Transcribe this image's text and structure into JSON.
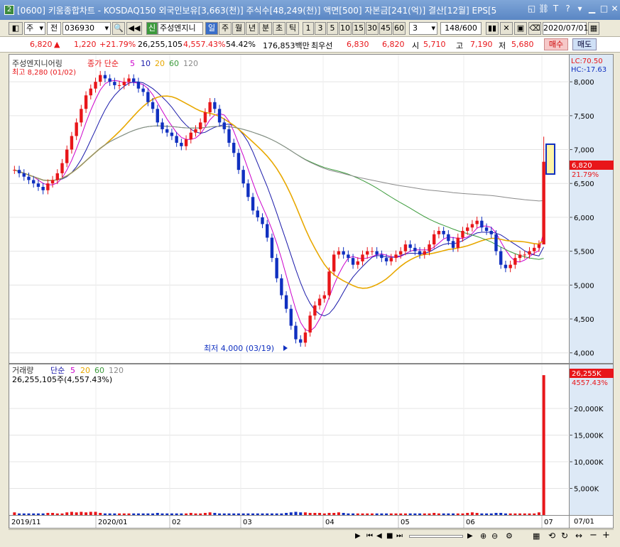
{
  "window": {
    "number": "2",
    "title": "[0600] 키움종합차트 - KOSDAQ150 외국인보유[3,663(천)] 주식수[48,249(천)] 액면[500] 자본금[241(억)] 결산[12월] EPS[5"
  },
  "toolbar": {
    "period_type": "주",
    "market": "전",
    "code": "036930",
    "badge": "신",
    "name": "주성엔지니",
    "periods": [
      "일",
      "주",
      "월",
      "년",
      "분",
      "초",
      "틱"
    ],
    "minutes": [
      "1",
      "3",
      "5",
      "10",
      "15",
      "30",
      "45",
      "60"
    ],
    "tick_value": "3",
    "count": "148/600",
    "date": "2020/07/01"
  },
  "quote": {
    "price": "6,820",
    "change_arrow": "▲",
    "change": "1,220",
    "change_pct": "+21.79%",
    "volume": "26,255,105",
    "volume_ratio": "4,557.43%",
    "turnover": "54.42%",
    "amount": "176,853백만",
    "best_label": "최우선",
    "ask": "6,830",
    "bid": "6,820",
    "open_label": "시",
    "open": "5,710",
    "high_label": "고",
    "high": "7,190",
    "low_label": "저",
    "low": "5,680",
    "buy_label": "매수",
    "sell_label": "매도"
  },
  "price_pane": {
    "legend_name": "주성엔지니어링",
    "legend_type": "종가 단순",
    "ma_labels": [
      "5",
      "10",
      "20",
      "60",
      "120"
    ],
    "high_note": "최고 8,280 (01/02)",
    "low_note": "최저 4,000 (03/19)",
    "lc_text": "LC:70.50",
    "hc_text": "HC:-17.63",
    "current_price": "6,820",
    "current_pct": "21.79%",
    "ticks": [
      "8,000",
      "7,500",
      "7,000",
      "6,500",
      "6,000",
      "5,500",
      "5,000",
      "4,500",
      "4,000"
    ]
  },
  "volume_pane": {
    "legend_name": "거래량",
    "legend_type": "단순",
    "ma_labels": [
      "5",
      "20",
      "60",
      "120"
    ],
    "value_text": "26,255,105주(4,557.43%)",
    "current_volume": "26,255K",
    "current_pct": "4557.43%",
    "ticks": [
      "20,000K",
      "15,000K",
      "10,000K",
      "5,000K"
    ]
  },
  "xaxis": [
    "2019/11",
    "2020/01",
    "02",
    "03",
    "04",
    "05",
    "06",
    "07"
  ],
  "axis_right_date": "07/01",
  "colors": {
    "up": "#e8161a",
    "down": "#1030c0",
    "ma5": "#cc00cc",
    "ma10": "#1a1aaa",
    "ma20": "#e8a800",
    "ma60": "#3a9a3a",
    "ma120": "#8a8a8a"
  },
  "chart_data": {
    "type": "candlestick",
    "ylim": [
      3850,
      8400
    ],
    "x_labels": [
      "2019/11",
      "2020/01",
      "02",
      "03",
      "04",
      "05",
      "06",
      "07"
    ],
    "closes": [
      6700,
      6650,
      6600,
      6550,
      6500,
      6450,
      6400,
      6500,
      6550,
      6650,
      6800,
      7000,
      7200,
      7400,
      7600,
      7800,
      7900,
      8000,
      8100,
      8050,
      8000,
      7950,
      7950,
      8000,
      8050,
      8000,
      7900,
      7850,
      7700,
      7600,
      7400,
      7300,
      7250,
      7200,
      7100,
      7050,
      7150,
      7250,
      7300,
      7400,
      7550,
      7700,
      7600,
      7400,
      7300,
      7100,
      6950,
      6700,
      6500,
      6300,
      6100,
      6000,
      5900,
      5700,
      5400,
      5100,
      4850,
      4650,
      4400,
      4200,
      4150,
      4300,
      4550,
      4700,
      4800,
      4850,
      5200,
      5450,
      5500,
      5450,
      5400,
      5300,
      5350,
      5450,
      5500,
      5500,
      5450,
      5400,
      5350,
      5400,
      5450,
      5500,
      5600,
      5550,
      5500,
      5450,
      5500,
      5600,
      5750,
      5800,
      5750,
      5650,
      5550,
      5700,
      5800,
      5850,
      5900,
      5950,
      5850,
      5800,
      5750,
      5500,
      5300,
      5250,
      5300,
      5400,
      5450,
      5450,
      5500,
      5550,
      5600,
      6820
    ],
    "volumes_k": [
      500,
      300,
      300,
      300,
      300,
      300,
      300,
      400,
      400,
      300,
      300,
      500,
      600,
      500,
      600,
      500,
      600,
      600,
      400,
      300,
      300,
      300,
      300,
      300,
      300,
      300,
      300,
      300,
      300,
      300,
      400,
      300,
      300,
      300,
      300,
      300,
      300,
      400,
      300,
      300,
      400,
      500,
      400,
      300,
      300,
      300,
      300,
      300,
      300,
      300,
      300,
      300,
      300,
      300,
      300,
      300,
      300,
      400,
      500,
      600,
      500,
      500,
      400,
      400,
      400,
      300,
      400,
      400,
      500,
      400,
      300,
      300,
      300,
      300,
      300,
      300,
      300,
      300,
      300,
      300,
      300,
      300,
      300,
      300,
      300,
      300,
      300,
      300,
      400,
      300,
      300,
      300,
      300,
      300,
      300,
      400,
      500,
      400,
      300,
      300,
      300,
      400,
      400,
      300,
      300,
      300,
      300,
      300,
      300,
      300,
      500,
      26255
    ],
    "volume_ylim": [
      0,
      28000
    ]
  }
}
